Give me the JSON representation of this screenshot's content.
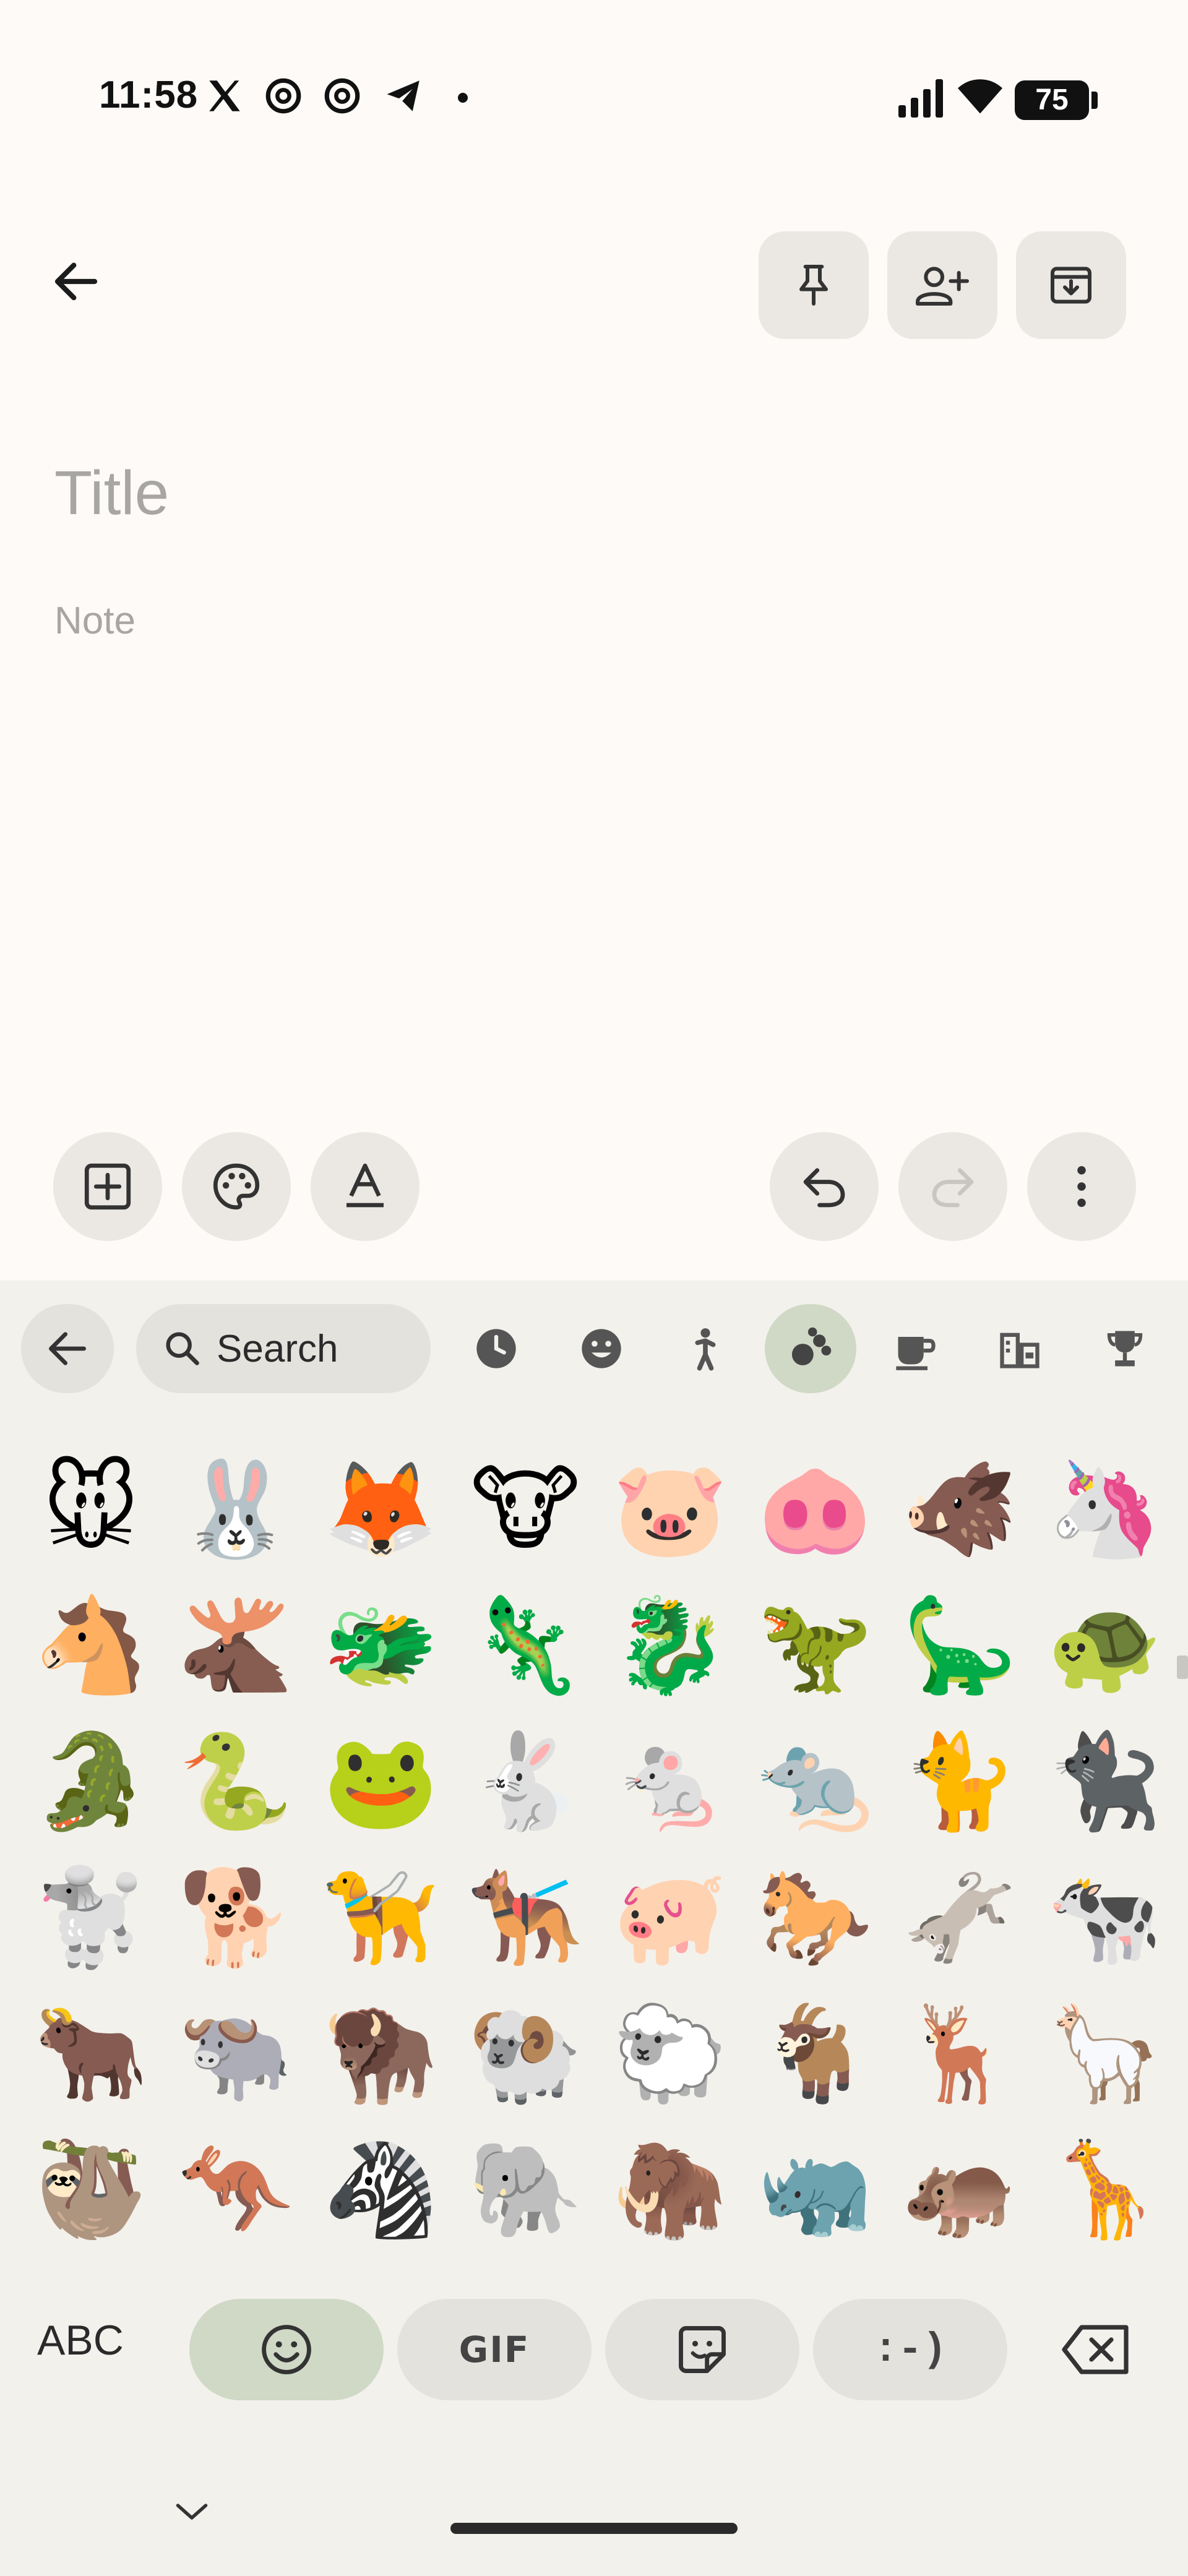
{
  "status_bar": {
    "time": "11:58",
    "notification_icons": [
      "x-icon",
      "threads-icon",
      "threads-icon",
      "telegram-icon",
      "dot-icon"
    ],
    "battery": "75"
  },
  "note_toolbar": {
    "buttons": [
      "back-arrow-icon",
      "pin-icon",
      "add-collaborator-icon",
      "archive-icon"
    ]
  },
  "note": {
    "title_placeholder": "Title",
    "body_placeholder": "Note"
  },
  "note_actions": {
    "left": [
      "add-box-icon",
      "palette-icon",
      "text-format-icon"
    ],
    "right": [
      "undo-icon",
      "redo-icon",
      "more-vert-icon"
    ]
  },
  "keyboard": {
    "search_placeholder": "Search",
    "categories": [
      "recent-icon",
      "smileys-icon",
      "people-icon",
      "animals-nature-icon",
      "food-drink-icon",
      "travel-places-icon",
      "activities-icon"
    ],
    "active_category": "animals-nature-icon",
    "emojis": [
      "🐭",
      "🐰",
      "🦊",
      "🐮",
      "🐷",
      "🐽",
      "🐗",
      "🦄",
      "🐴",
      "🫎",
      "🐲",
      "🦎",
      "🐉",
      "🦖",
      "🦕",
      "🐢",
      "🐊",
      "🐍",
      "🐸",
      "🐇",
      "🐁",
      "🐀",
      "🐈",
      "🐈‍⬛",
      "🐩",
      "🐕",
      "🦮",
      "🐕‍🦺",
      "🐖",
      "🐎",
      "🫏",
      "🐄",
      "🐂",
      "🐃",
      "🦬",
      "🐏",
      "🐑",
      "🐐",
      "🦌",
      "🦙",
      "🦥",
      "🦘",
      "🦓",
      "🐘",
      "🦣",
      "🦏",
      "🦛",
      "🦒"
    ],
    "bottom": {
      "abc": "ABC",
      "gif": "GIF",
      "emoticon": ":-)"
    }
  },
  "colors": {
    "background": "#fdfaf7",
    "button_bg": "#ebe8e3",
    "keyboard_bg": "#f3f1ec",
    "active_green": "#cfd9c6",
    "placeholder": "#a7a6a3"
  }
}
